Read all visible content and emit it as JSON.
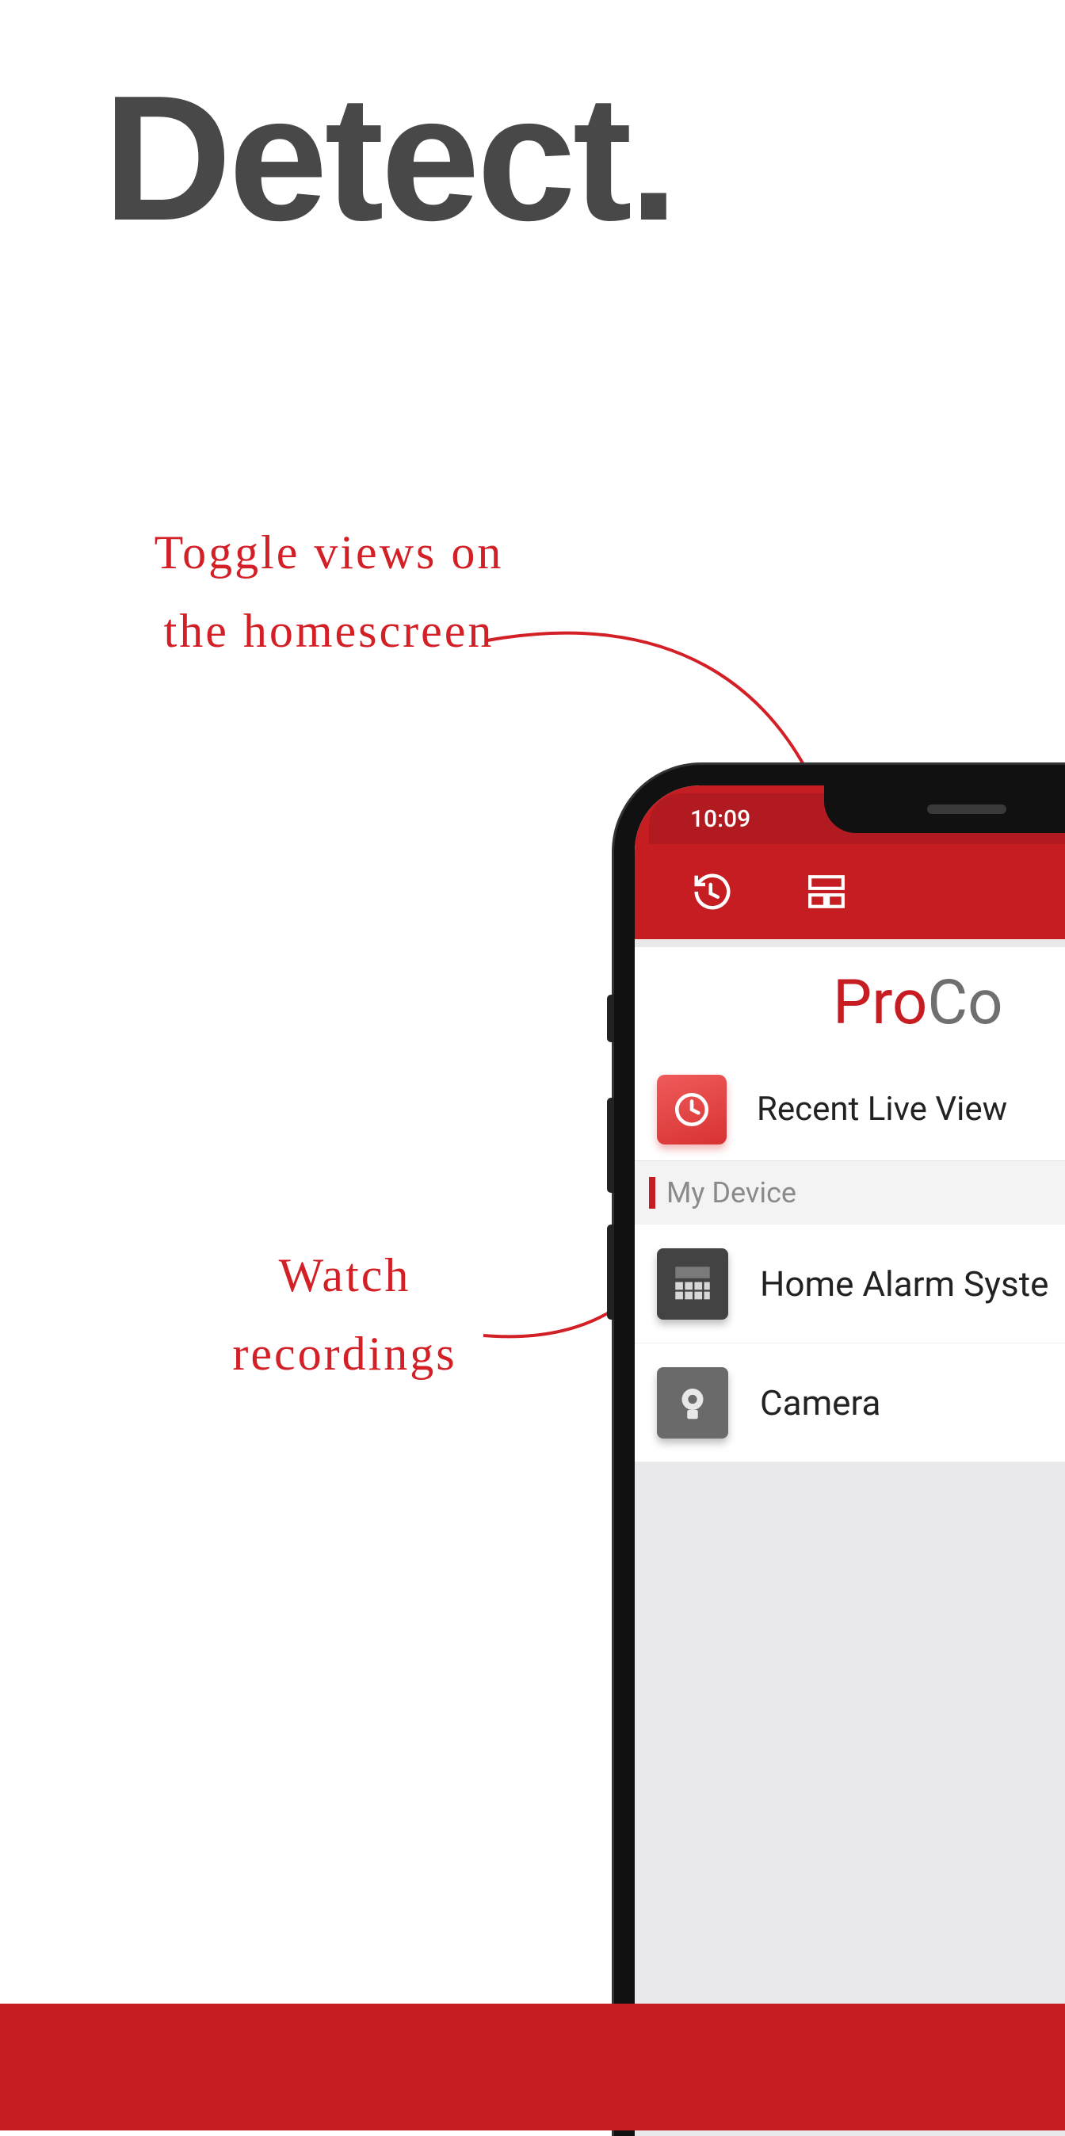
{
  "headline": "Detect.",
  "annotations": {
    "toggle_views": "Toggle views on the homescreen",
    "watch_recordings": "Watch recordings"
  },
  "phone": {
    "status_time": "10:09",
    "brand_part1": "Pro",
    "brand_part2": "Co",
    "recent_live_view": "Recent Live View",
    "section_header": "My Device",
    "devices": {
      "alarm": "Home Alarm Syste",
      "camera": "Camera"
    }
  },
  "colors": {
    "brand_red": "#c61d23",
    "text_gray": "#484848"
  }
}
